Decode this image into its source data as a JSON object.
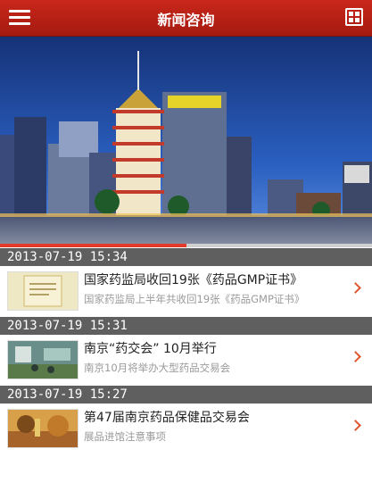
{
  "header": {
    "title": "新闻咨询",
    "menu_icon": "hamburger-menu-icon",
    "grid_icon": "grid-apps-icon"
  },
  "banner": {
    "progress": 0.5,
    "colors": {
      "sky": "#1b3d8c",
      "accent": "#e33a2a"
    }
  },
  "news": [
    {
      "date": "2013-07-19 15:34",
      "title": "国家药监局收回19张《药品GMP证书》",
      "summary": "国家药监局上半年共收回19张《药品GMP证书》"
    },
    {
      "date": "2013-07-19 15:31",
      "title": "南京“药交会” 10月举行",
      "summary": "南京10月将举办大型药品交易会"
    },
    {
      "date": "2013-07-19 15:27",
      "title": "第47届南京药品保健品交易会",
      "summary": "展品进馆注意事项"
    }
  ],
  "colors": {
    "header_red": "#b81f14",
    "date_bar": "#5f5f5f",
    "chevron": "#e0552e"
  }
}
